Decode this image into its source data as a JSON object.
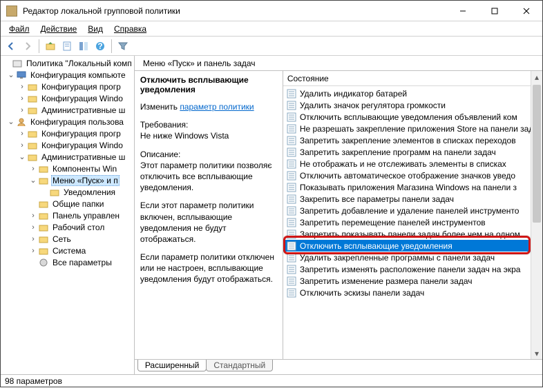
{
  "window": {
    "title": "Редактор локальной групповой политики"
  },
  "menu": {
    "file": "Файл",
    "action": "Действие",
    "view": "Вид",
    "help": "Справка"
  },
  "tree": {
    "root": "Политика \"Локальный комп",
    "compConf": "Конфигурация компьюте",
    "compProg": "Конфигурация прогр",
    "compWin": "Конфигурация Windo",
    "compAdmin": "Административные ш",
    "userConf": "Конфигурация пользова",
    "userProg": "Конфигурация прогр",
    "userWin": "Конфигурация Windo",
    "userAdmin": "Административные ш",
    "compWinSub": "Компоненты Win",
    "startMenu": "Меню «Пуск» и п",
    "notif": "Уведомления",
    "shared": "Общие папки",
    "ctrlPanel": "Панель управлен",
    "desktop": "Рабочий стол",
    "network": "Сеть",
    "system": "Система",
    "allParams": "Все параметры"
  },
  "path": {
    "label": "Меню «Пуск» и панель задач"
  },
  "details": {
    "title": "Отключить всплывающие уведомления",
    "changeLabel": "Изменить",
    "changeLink": "параметр политики",
    "reqLabel": "Требования:",
    "reqText": "Не ниже Windows Vista",
    "descLabel": "Описание:",
    "desc1": "Этот параметр политики позволяє отключить все всплывающие уведомления.",
    "desc2": "Если этот параметр политики включен, всплывающие уведомления не будут отображаться.",
    "desc3": "Если параметр политики отключен или не настроен, всплывающие уведомления будут отображаться."
  },
  "listHeader": "Состояние",
  "items": [
    "Удалить индикатор батарей",
    "Удалить значок регулятора громкости",
    "Отключить всплывающие уведомления объявлений ком",
    "Не разрешать закрепление приложения Store на панели задач",
    "Запретить закрепление элементов в списках переходов",
    "Запретить закрепление программ на панели задач",
    "Не отображать и не отслеживать элементы в списках",
    "Отключить автоматическое отображение значков уведо",
    "Показывать приложения Магазина Windows на панели з",
    "Закрепить все параметры панели задач",
    "Запретить добавление и удаление панелей инструменто",
    "Запретить перемещение панелей инструментов",
    "Запретить показывать панели задач более чем на одном",
    "Отключить всплывающие уведомления",
    "Удалить закрепленные программы с панели задач",
    "Запретить изменять расположение панели задач на экра",
    "Запретить изменение размера панели задач",
    "Отключить эскизы панели задач"
  ],
  "highlightIndex": 13,
  "tabs": {
    "ext": "Расширенный",
    "std": "Стандартный"
  },
  "status": "98 параметров"
}
